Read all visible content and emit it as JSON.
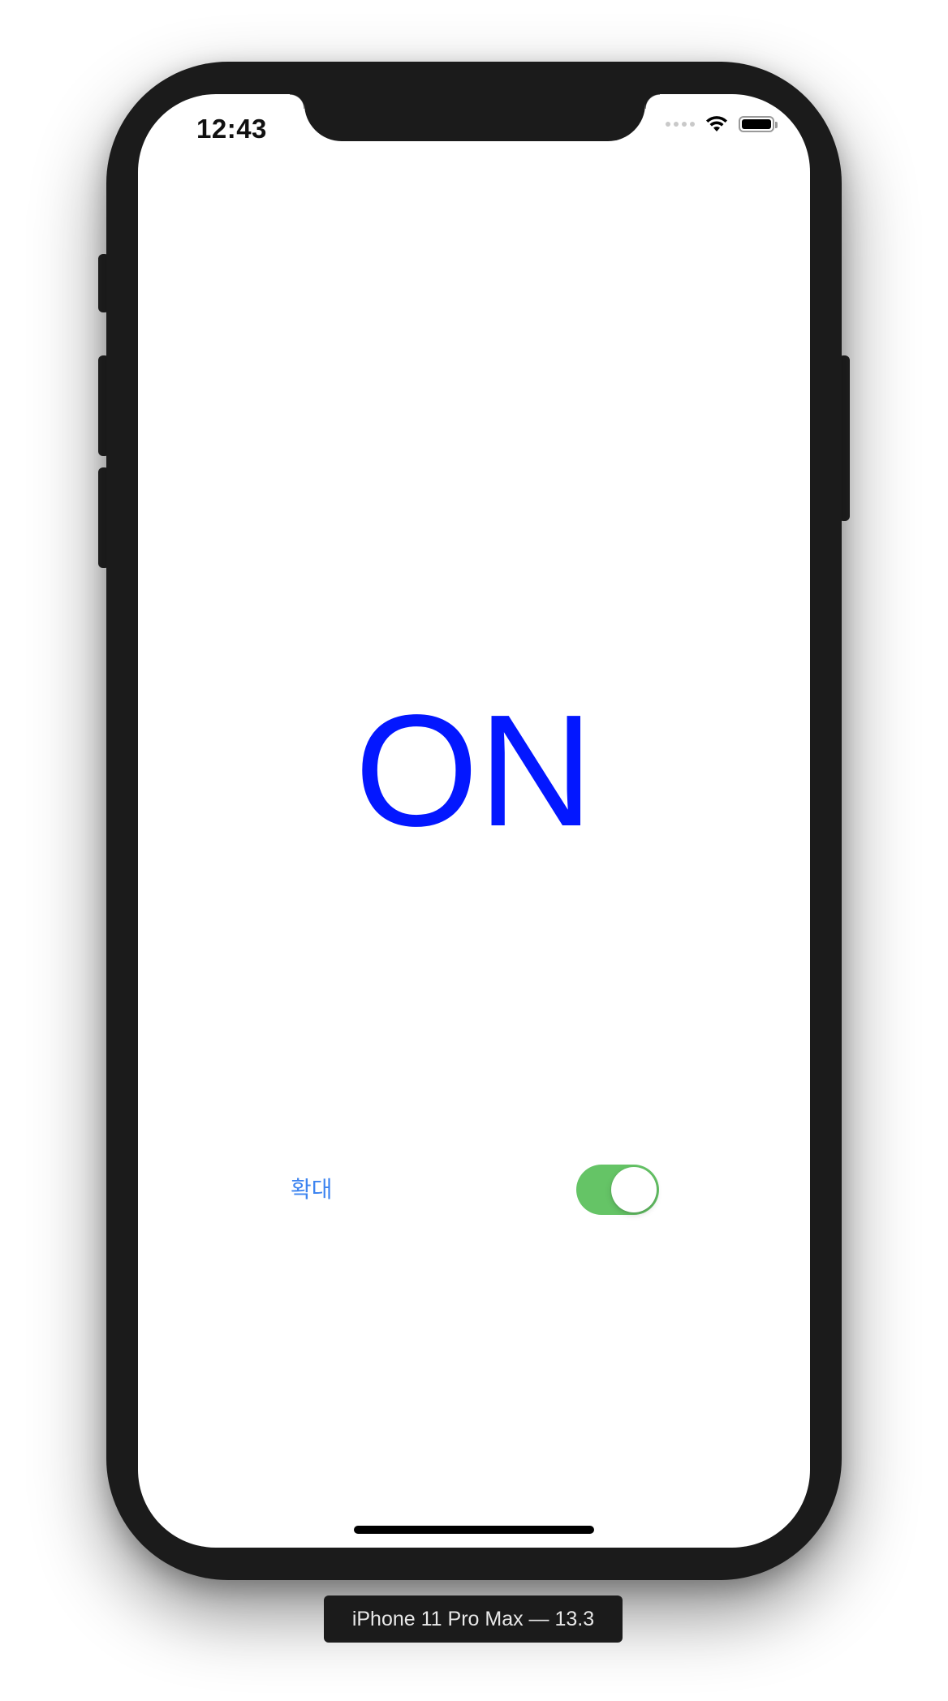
{
  "status_bar": {
    "time": "12:43",
    "icons": [
      "cellular-signal-icon",
      "wifi-icon",
      "battery-icon"
    ]
  },
  "main": {
    "state_text": "ON",
    "state_color": "#0317ff",
    "zoom_label": "확대",
    "zoom_label_color": "#3d84f0",
    "zoom_switch": {
      "is_on": true,
      "on_color": "#65c466"
    }
  },
  "simulator": {
    "device_caption": "iPhone 11 Pro Max — 13.3"
  }
}
